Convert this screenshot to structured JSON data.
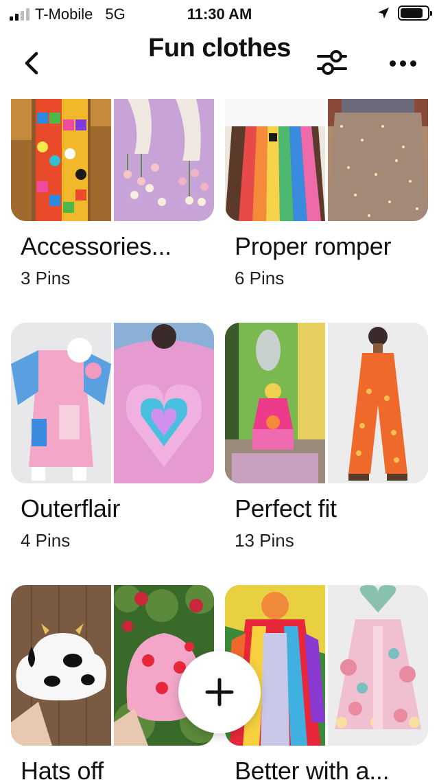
{
  "status_bar": {
    "carrier": "T-Mobile",
    "network": "5G",
    "time": "11:30 AM",
    "signal_bars": 2,
    "signal_bars_total": 4,
    "battery_level": 0.85
  },
  "header": {
    "title": "Fun clothes",
    "back_icon": "chevron-left-icon",
    "filter_icon": "sliders-icon",
    "more_icon": "more-horizontal-icon"
  },
  "boards": [
    {
      "name": "Accessories...",
      "pins": "3 Pins",
      "covers": [
        "crochet patchwork scarf",
        "crochet flower scarf"
      ]
    },
    {
      "name": "Proper romper",
      "pins": "6 Pins",
      "covers": [
        "rainbow stripe overalls",
        "star tulle skirt"
      ]
    },
    {
      "name": "Outerflair",
      "pins": "4 Pins",
      "covers": [
        "pink patchwork coat",
        "heart puffer jacket"
      ]
    },
    {
      "name": "Perfect fit",
      "pins": "13 Pins",
      "covers": [
        "pink outfit on porch",
        "orange crochet jumpsuit"
      ]
    },
    {
      "name": "Hats off",
      "pins": "",
      "covers": [
        "cow crochet bucket hat",
        "strawberry crochet hat"
      ]
    },
    {
      "name": "Better with a...",
      "pins": "",
      "covers": [
        "rainbow crochet cardigan",
        "pink floral crochet cardigan"
      ]
    }
  ],
  "fab": {
    "icon": "plus-icon"
  },
  "colors": {
    "background": "#ffffff",
    "text": "#111111"
  }
}
